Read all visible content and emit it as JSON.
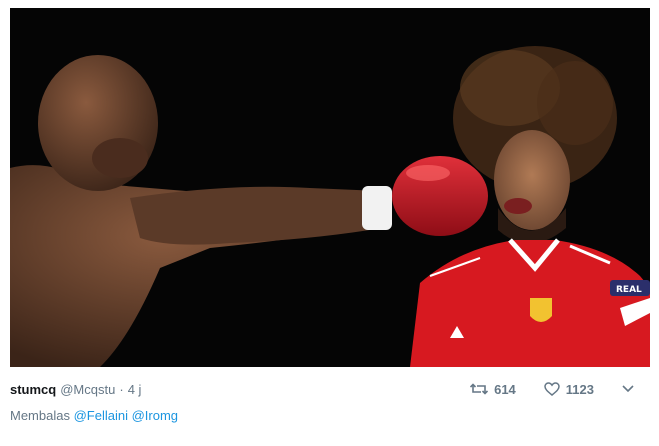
{
  "tweet": {
    "display_name": "stumcq",
    "handle": "@Mcqstu",
    "separator": "·",
    "time": "4 j",
    "retweet_count": "614",
    "like_count": "1123",
    "reply_prefix": "Membalas",
    "mentions": [
      "@Fellaini",
      "@Iromg"
    ]
  },
  "image": {
    "jersey_text": "REAL"
  },
  "icons": {
    "retweet": "retweet-icon",
    "like": "heart-icon",
    "more": "chevron-down-icon"
  },
  "colors": {
    "handle_gray": "#657786",
    "link_blue": "#1b95e0",
    "name_black": "#14171a",
    "jersey_red": "#d71920",
    "glove_red": "#c8102e"
  }
}
